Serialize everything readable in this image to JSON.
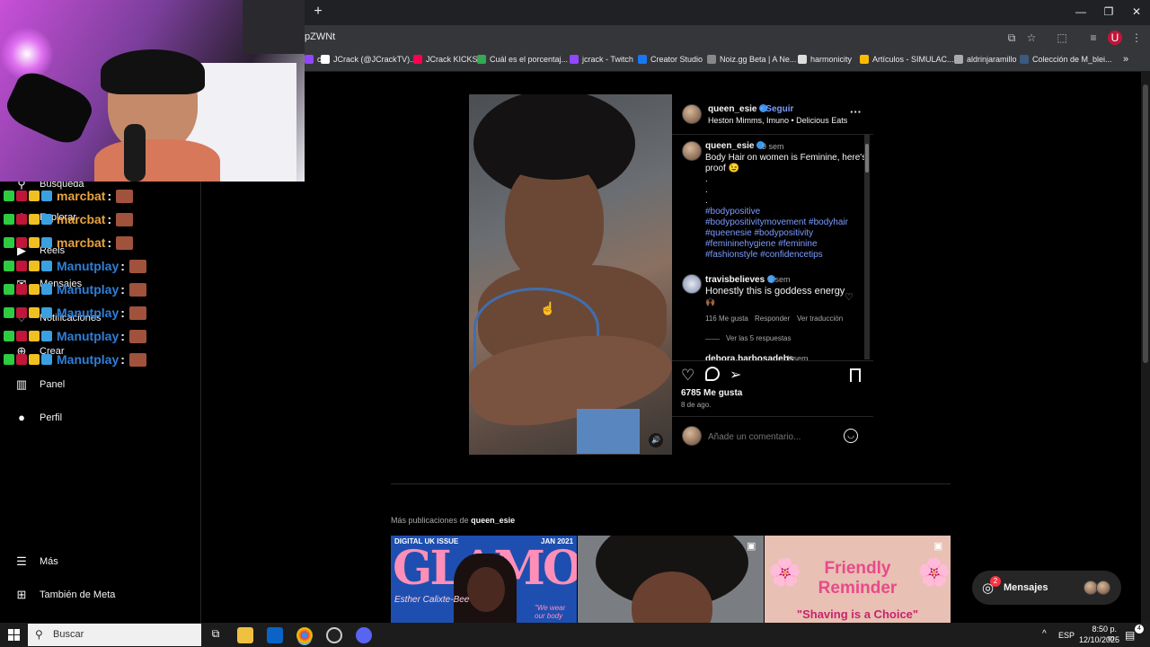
{
  "browser": {
    "new_tab": "+",
    "url": "pZWNt",
    "window_controls": [
      "—",
      "❐",
      "✕"
    ],
    "bookmarks": [
      {
        "label": "ch",
        "icon": "twitch-icon",
        "color": "#9146ff"
      },
      {
        "label": "JCrack (@JCrackTV)...",
        "icon": "x-icon",
        "color": "#ffffff"
      },
      {
        "label": "JCrack KICKS",
        "icon": "tiktok-icon",
        "color": "#ff0050"
      },
      {
        "label": "Cuál es el porcentaj...",
        "icon": "doc-icon",
        "color": "#34a853"
      },
      {
        "label": "jcrack - Twitch",
        "icon": "twitch-icon",
        "color": "#9146ff"
      },
      {
        "label": "Creator Studio",
        "icon": "facebook-icon",
        "color": "#1877f2"
      },
      {
        "label": "Noiz.gg Beta | A Ne...",
        "icon": "noiz-icon",
        "color": "#888888"
      },
      {
        "label": "harmonicity",
        "icon": "image-icon",
        "color": "#dddddd"
      },
      {
        "label": "Artículos - SIMULAC...",
        "icon": "drive-icon",
        "color": "#fbbc04"
      },
      {
        "label": "aldrinjaramillo",
        "icon": "globe-icon",
        "color": "#aaaaaa"
      },
      {
        "label": "Colección de M_blei...",
        "icon": "globe-icon",
        "color": "#3a5a80"
      }
    ]
  },
  "sidebar": {
    "items": [
      {
        "label": "Búsqueda",
        "icon": "search-icon"
      },
      {
        "label": "Explorar",
        "icon": "compass-icon"
      },
      {
        "label": "Reels",
        "icon": "reels-icon"
      },
      {
        "label": "Mensajes",
        "icon": "messenger-icon",
        "badge": "2"
      },
      {
        "label": "Notificaciones",
        "icon": "heart-icon"
      },
      {
        "label": "Crear",
        "icon": "plus-icon"
      },
      {
        "label": "Panel",
        "icon": "chart-icon"
      },
      {
        "label": "Perfil",
        "icon": "avatar-icon"
      }
    ],
    "more": "Más",
    "meta": "También de Meta"
  },
  "stream_chat": [
    {
      "user": "marcbat",
      "color": "#e8a33c"
    },
    {
      "user": "marcbat",
      "color": "#e8a33c"
    },
    {
      "user": "marcbat",
      "color": "#e8a33c"
    },
    {
      "user": "Manutplay",
      "color": "#2e7fd8"
    },
    {
      "user": "Manutplay",
      "color": "#2e7fd8"
    },
    {
      "user": "Manutplay",
      "color": "#2e7fd8"
    },
    {
      "user": "Manutplay",
      "color": "#2e7fd8"
    },
    {
      "user": "Manutplay",
      "color": "#2e7fd8"
    }
  ],
  "post": {
    "author": "queen_esie",
    "follow": "Seguir",
    "audio": "Heston Mimms, Imuno • Delicious Eats",
    "more": "···",
    "caption_user": "queen_esie",
    "caption_time": "9 sem",
    "caption_line1": "Body Hair on women is Feminine, here's",
    "caption_line2": "proof 😉",
    "dots": [
      ".",
      ".",
      "."
    ],
    "hashtags": [
      "#bodypositive",
      "#bodypositivitymovement #bodyhair",
      "#queenesie #bodypositivity",
      "#femininehygiene #feminine",
      "#fashionstyle #confidencetips"
    ],
    "comment": {
      "user": "travisbelieves",
      "time": "9 sem",
      "text": "Honestly this is goddess energy",
      "emoji": "🙌🏾",
      "likes": "116 Me gusta",
      "reply": "Responder",
      "translate": "Ver traducción",
      "view_replies": "Ver las 5 respuestas"
    },
    "next_comment_user": "debora.barbosadebs",
    "next_comment_time": "1 sem",
    "like_count": "6785 Me gusta",
    "date": "8 de ago.",
    "comment_placeholder": "Añade un comentario...",
    "mute_icon": "🔊"
  },
  "more_posts": {
    "label": "Más publicaciones de",
    "user": "queen_esie",
    "thumbs": [
      {
        "top": "DIGITAL UK ISSUE",
        "date": "JAN 2021",
        "title": "GLAMOUR",
        "name": "Esther Calixte-Bee",
        "sub": "\"We wear our body"
      },
      {
        "title": ""
      },
      {
        "line1": "Friendly",
        "line2": "Reminder",
        "line3": "\"Shaving is a Choice\""
      }
    ]
  },
  "messages_pill": {
    "label": "Mensajes",
    "badge": "2"
  },
  "taskbar": {
    "search": "Buscar",
    "lang": "ESP",
    "time": "8:50 p. m.",
    "date": "12/10/2025",
    "notif_badge": "4"
  }
}
